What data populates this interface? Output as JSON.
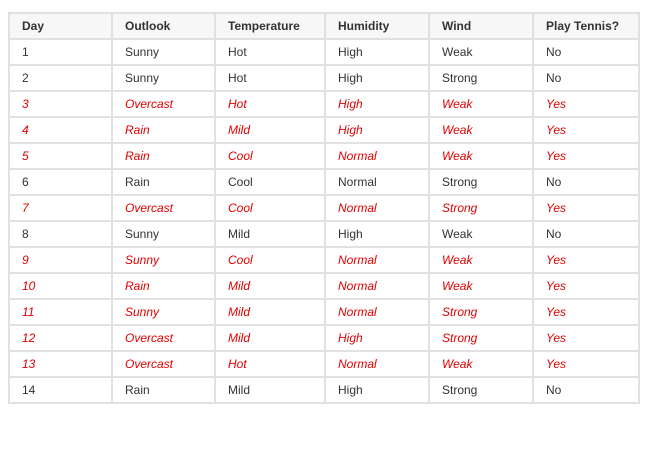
{
  "table": {
    "headers": [
      "Day",
      "Outlook",
      "Temperature",
      "Humidity",
      "Wind",
      "Play Tennis?"
    ],
    "rows": [
      [
        "1",
        "Sunny",
        "Hot",
        "High",
        "Weak",
        "No"
      ],
      [
        "2",
        "Sunny",
        "Hot",
        "High",
        "Strong",
        "No"
      ],
      [
        "3",
        "Overcast",
        "Hot",
        "High",
        "Weak",
        "Yes"
      ],
      [
        "4",
        "Rain",
        "Mild",
        "High",
        "Weak",
        "Yes"
      ],
      [
        "5",
        "Rain",
        "Cool",
        "Normal",
        "Weak",
        "Yes"
      ],
      [
        "6",
        "Rain",
        "Cool",
        "Normal",
        "Strong",
        "No"
      ],
      [
        "7",
        "Overcast",
        "Cool",
        "Normal",
        "Strong",
        "Yes"
      ],
      [
        "8",
        "Sunny",
        "Mild",
        "High",
        "Weak",
        "No"
      ],
      [
        "9",
        "Sunny",
        "Cool",
        "Normal",
        "Weak",
        "Yes"
      ],
      [
        "10",
        "Rain",
        "Mild",
        "Normal",
        "Weak",
        "Yes"
      ],
      [
        "11",
        "Sunny",
        "Mild",
        "Normal",
        "Strong",
        "Yes"
      ],
      [
        "12",
        "Overcast",
        "Mild",
        "High",
        "Strong",
        "Yes"
      ],
      [
        "13",
        "Overcast",
        "Hot",
        "Normal",
        "Weak",
        "Yes"
      ],
      [
        "14",
        "Rain",
        "Mild",
        "High",
        "Strong",
        "No"
      ]
    ]
  },
  "colors": {
    "positive_row_text": "#e00000",
    "default_text": "#333333",
    "header_background": "#f7f7f7",
    "border": "#e1e1e1"
  }
}
